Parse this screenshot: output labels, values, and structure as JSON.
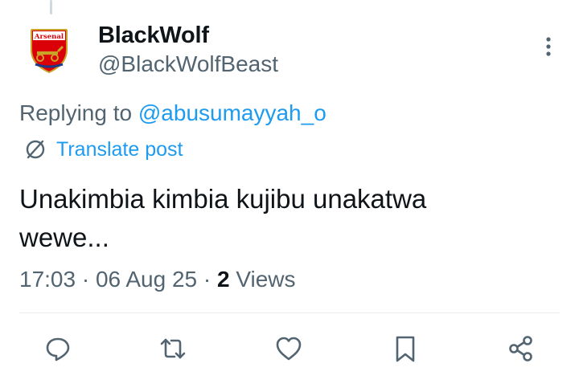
{
  "post": {
    "display_name": "BlackWolf",
    "handle": "@BlackWolfBeast",
    "avatar_text": "Arsenal",
    "replying_prefix": "Replying to ",
    "replying_handle": "@abusumayyah_o",
    "translate_label": "Translate post",
    "text_line1": "Unakimbia kimbia kujibu unakatwa",
    "text_line2": "wewe...",
    "time": "17:03",
    "date": "06 Aug 25",
    "views_count": "2",
    "views_label": "Views"
  },
  "icons": {
    "more": "more-vertical-icon",
    "translate": "translate-icon",
    "reply": "reply-icon",
    "repost": "repost-icon",
    "like": "like-icon",
    "bookmark": "bookmark-icon",
    "share": "share-icon"
  },
  "colors": {
    "link": "#1d9bf0",
    "secondary_text": "#536471",
    "primary_text": "#0f1419",
    "badge_red": "#db0007"
  }
}
